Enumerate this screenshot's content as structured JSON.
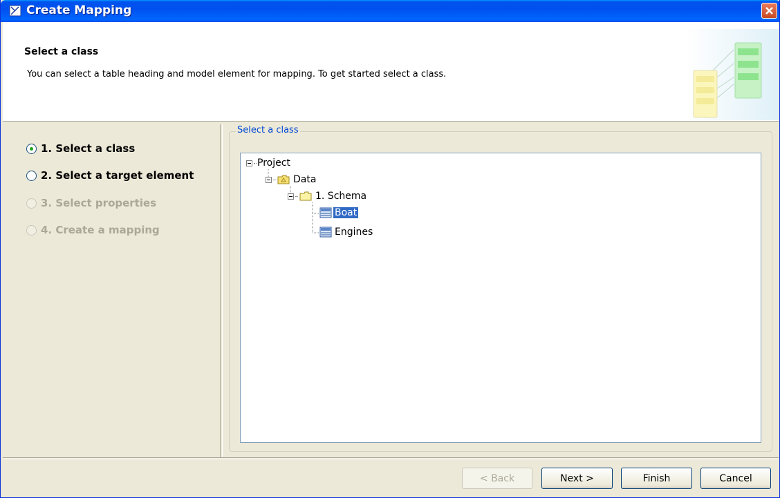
{
  "window": {
    "title": "Create Mapping"
  },
  "header": {
    "title": "Select a class",
    "description": "You can select a table heading and model element for mapping. To get started select a class."
  },
  "steps": [
    {
      "label": "1. Select a class",
      "state": "active"
    },
    {
      "label": "2. Select a target element",
      "state": "enabled"
    },
    {
      "label": "3. Select properties",
      "state": "disabled"
    },
    {
      "label": "4. Create a mapping",
      "state": "disabled"
    }
  ],
  "panel": {
    "group_label": "Select a class"
  },
  "tree": {
    "root": "Project",
    "package": "Data",
    "schema": "1. Schema",
    "classes": [
      "Boat",
      "Engines"
    ],
    "selected": "Boat"
  },
  "buttons": {
    "back": "< Back",
    "next": "Next >",
    "finish": "Finish",
    "cancel": "Cancel"
  },
  "colors": {
    "titlebar": "#0054e3",
    "selection": "#316ac5",
    "group_label": "#0046d5",
    "dialog_bg": "#ece9d8"
  }
}
